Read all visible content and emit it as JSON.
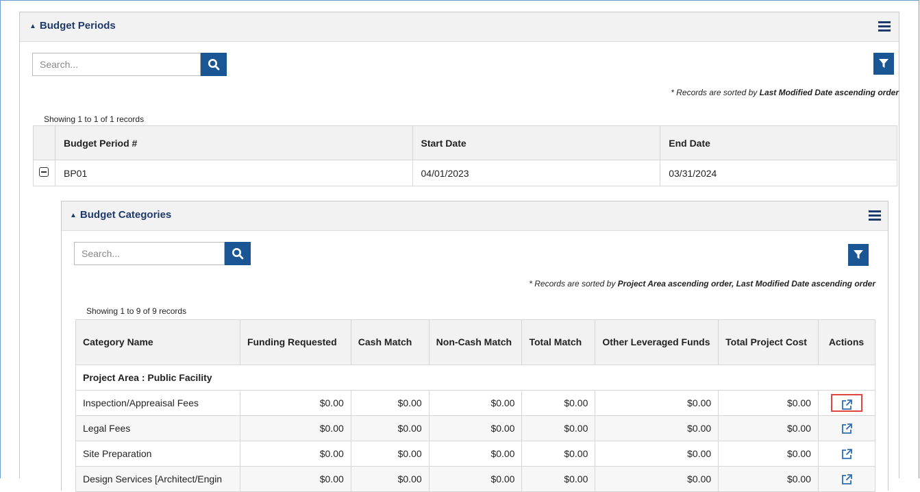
{
  "budget_periods": {
    "title": "Budget Periods",
    "search_placeholder": "Search...",
    "sort_note_prefix": "* Records are sorted by ",
    "sort_note_bold": "Last Modified Date ascending order",
    "showing": "Showing 1 to 1 of 1 records",
    "columns": [
      "Budget Period #",
      "Start Date",
      "End Date"
    ],
    "rows": [
      {
        "period": "BP01",
        "start": "04/01/2023",
        "end": "03/31/2024"
      }
    ]
  },
  "budget_categories": {
    "title": "Budget Categories",
    "search_placeholder": "Search...",
    "sort_note_prefix": "* Records are sorted by ",
    "sort_note_bold": "Project Area ascending order, Last Modified Date ascending order",
    "showing": "Showing 1 to 9 of 9 records",
    "columns": [
      "Category Name",
      "Funding Requested",
      "Cash Match",
      "Non-Cash Match",
      "Total Match",
      "Other Leveraged Funds",
      "Total Project Cost",
      "Actions"
    ],
    "group_label": "Project Area : Public Facility",
    "rows": [
      {
        "name": "Inspection/Appreaisal Fees",
        "funding": "$0.00",
        "cash": "$0.00",
        "noncash": "$0.00",
        "total_match": "$0.00",
        "other": "$0.00",
        "total_cost": "$0.00"
      },
      {
        "name": "Legal Fees",
        "funding": "$0.00",
        "cash": "$0.00",
        "noncash": "$0.00",
        "total_match": "$0.00",
        "other": "$0.00",
        "total_cost": "$0.00"
      },
      {
        "name": "Site Preparation",
        "funding": "$0.00",
        "cash": "$0.00",
        "noncash": "$0.00",
        "total_match": "$0.00",
        "other": "$0.00",
        "total_cost": "$0.00"
      },
      {
        "name": "Design Services [Architect/Engin",
        "funding": "$0.00",
        "cash": "$0.00",
        "noncash": "$0.00",
        "total_match": "$0.00",
        "other": "$0.00",
        "total_cost": "$0.00"
      }
    ]
  },
  "colors": {
    "accent": "#1a5694",
    "title": "#1e3a6b",
    "highlight": "#e0463e"
  },
  "icons": {
    "search": "search-icon",
    "filter": "filter-icon",
    "menu": "hamburger-menu-icon",
    "external": "external-link-icon",
    "collapse": "collapse-icon"
  }
}
